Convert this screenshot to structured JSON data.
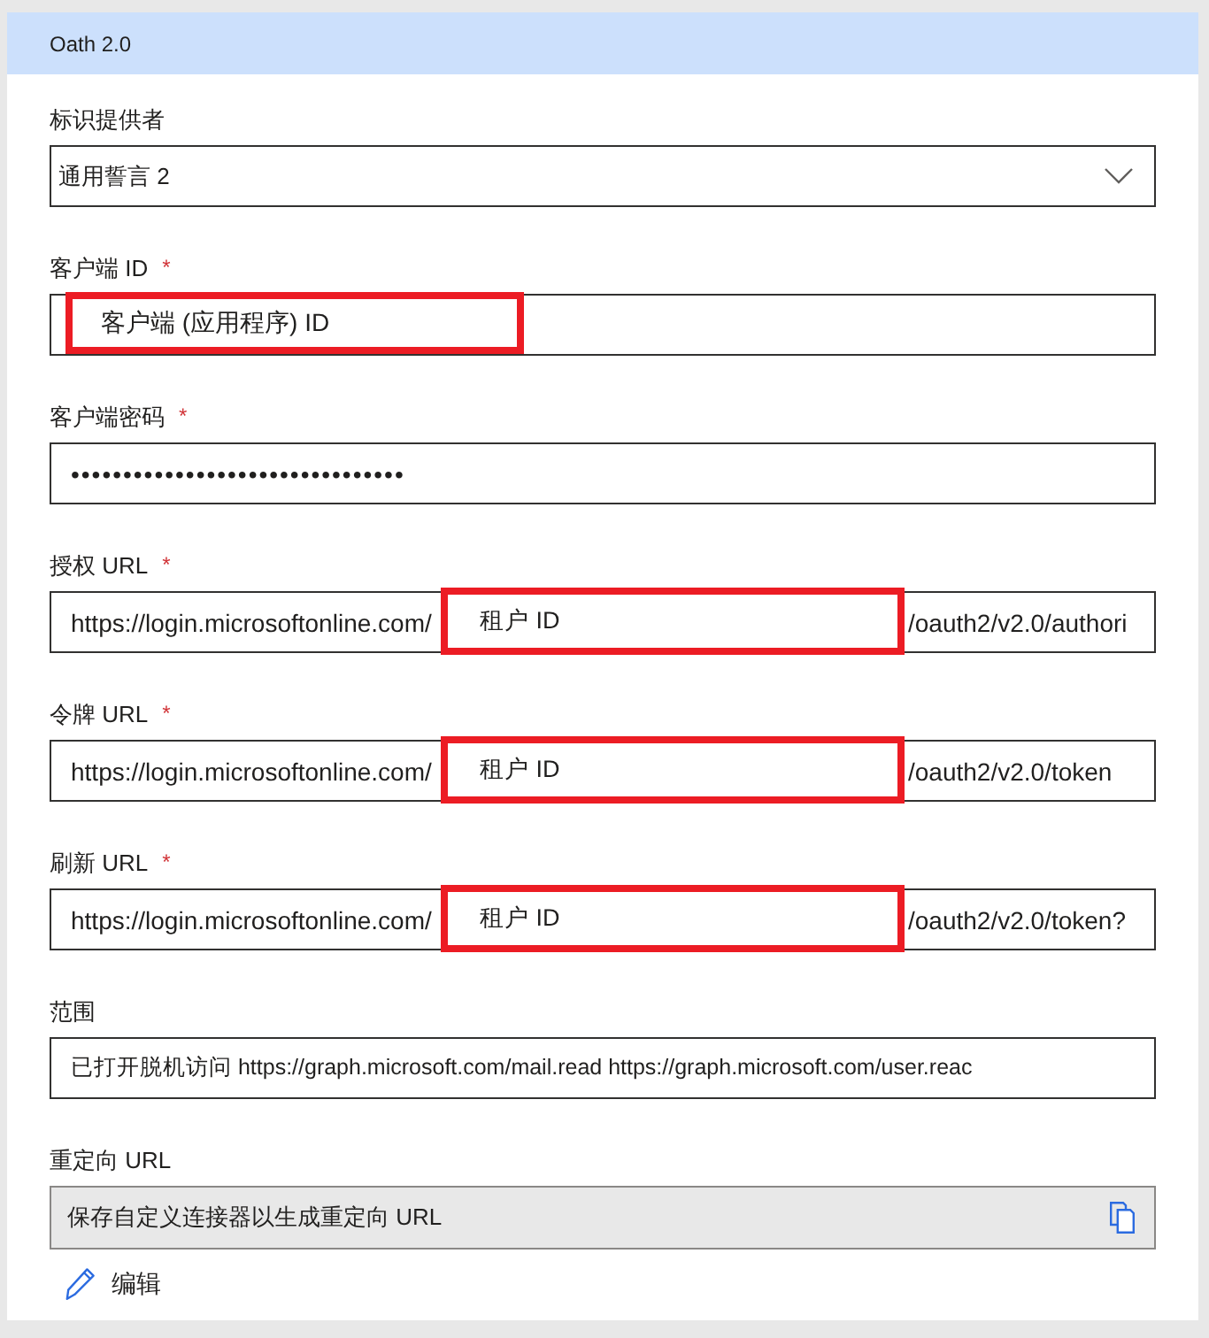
{
  "section": {
    "title": "Oath 2.0"
  },
  "fields": [
    {
      "kind": "dropdown",
      "label": "标识提供者",
      "value": "通用誓言 2"
    },
    {
      "kind": "text",
      "label": "客户端 ID",
      "required_mark": "*",
      "highlight": "客户端 (应用程序) ID"
    },
    {
      "kind": "password",
      "label": "客户端密码",
      "required_mark": "*",
      "value": "••••••••••••••••••••••••••••••••"
    },
    {
      "kind": "url",
      "label": "授权 URL",
      "required_mark": "*",
      "prefix": "https://login.microsoftonline.com/",
      "highlight": "租户 ID",
      "suffix": "/oauth2/v2.0/authori"
    },
    {
      "kind": "url",
      "label": "令牌 URL",
      "required_mark": "*",
      "prefix": "https://login.microsoftonline.com/",
      "highlight": "租户 ID",
      "suffix": "/oauth2/v2.0/token"
    },
    {
      "kind": "url",
      "label": "刷新 URL",
      "required_mark": "*",
      "prefix": "https://login.microsoftonline.com/",
      "highlight": "租户 ID",
      "suffix": "/oauth2/v2.0/token?"
    },
    {
      "kind": "text",
      "label": "范围",
      "value": "已打开脱机访问 https://graph.microsoft.com/mail.read https://graph.microsoft.com/user.reac"
    },
    {
      "kind": "readonly",
      "label": "重定向 URL",
      "value": "保存自定义连接器以生成重定向 URL"
    }
  ],
  "edit_link": {
    "label": "编辑"
  }
}
